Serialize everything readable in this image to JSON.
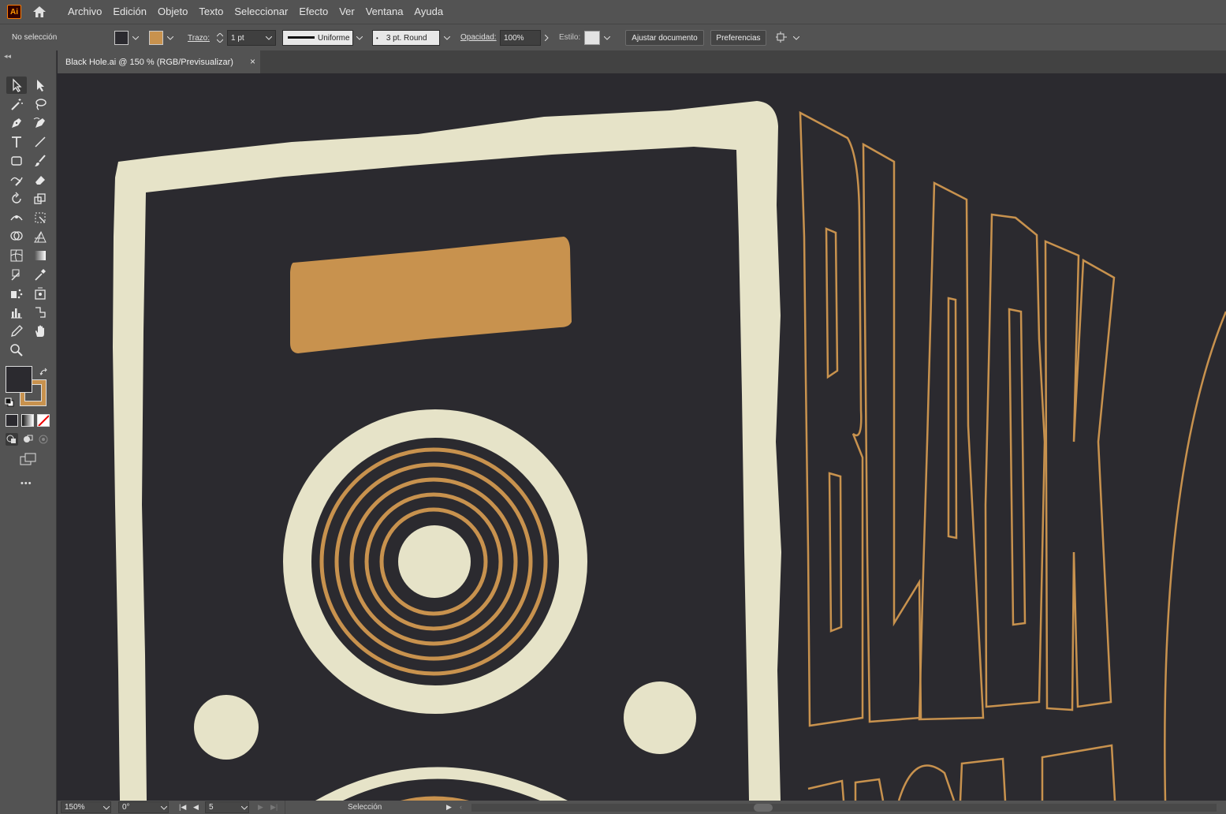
{
  "app": {
    "logo_text": "Ai"
  },
  "menu": [
    "Archivo",
    "Edición",
    "Objeto",
    "Texto",
    "Seleccionar",
    "Efecto",
    "Ver",
    "Ventana",
    "Ayuda"
  ],
  "control": {
    "selection_label": "No selección",
    "stroke_label": "Trazo:",
    "stroke_weight": "1 pt",
    "profile": "Uniforme",
    "brush": "3 pt. Round",
    "opacity_label": "Opacidad:",
    "opacity_value": "100%",
    "style_label": "Estilo:",
    "fit_button": "Ajustar documento",
    "prefs_button": "Preferencias"
  },
  "document": {
    "tab_title": "Black Hole.ai @ 150 % (RGB/Previsualizar)",
    "close": "×"
  },
  "status": {
    "zoom": "150%",
    "rotation": "0°",
    "artboard": "5",
    "tool": "Selección"
  },
  "toolbar": {
    "more": "•••",
    "collapse": "◂◂"
  },
  "colors": {
    "ui": "#535353",
    "canvas": "#2b2a2f",
    "cream": "#e6e3c8",
    "orange": "#c8924e"
  }
}
